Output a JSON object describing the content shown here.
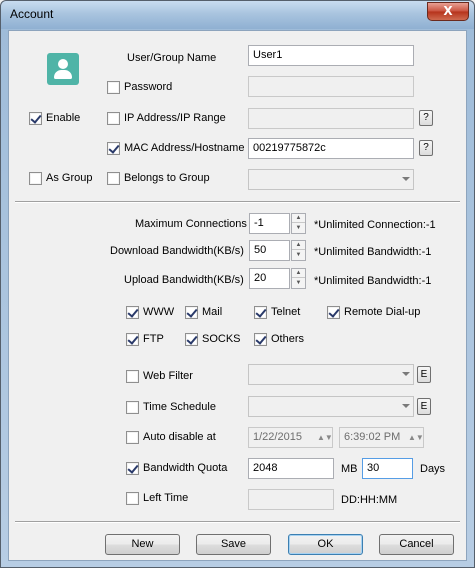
{
  "window": {
    "title": "Account",
    "close_glyph": "X"
  },
  "user": {
    "name_label": "User/Group Name",
    "name_value": "User1",
    "password_label": "Password",
    "password_checked": false,
    "password_value": "",
    "enable_label": "Enable",
    "enable_checked": true,
    "ip_label": "IP Address/IP Range",
    "ip_checked": false,
    "ip_value": "",
    "ip_help": "?",
    "mac_label": "MAC Address/Hostname",
    "mac_checked": true,
    "mac_value": "00219775872c",
    "mac_help": "?",
    "as_group_label": "As Group",
    "as_group_checked": false,
    "belongs_label": "Belongs to Group",
    "belongs_checked": false,
    "belongs_value": ""
  },
  "limits": {
    "max_conn_label": "Maximum Connections",
    "max_conn_value": "-1",
    "max_conn_note": "*Unlimited Connection:-1",
    "download_label": "Download Bandwidth(KB/s)",
    "download_value": "50",
    "download_note": "*Unlimited Bandwidth:-1",
    "upload_label": "Upload Bandwidth(KB/s)",
    "upload_value": "20",
    "upload_note": "*Unlimited Bandwidth:-1"
  },
  "services": [
    {
      "label": "WWW",
      "checked": true
    },
    {
      "label": "Mail",
      "checked": true
    },
    {
      "label": "Telnet",
      "checked": true
    },
    {
      "label": "Remote Dial-up",
      "checked": true
    },
    {
      "label": "FTP",
      "checked": true
    },
    {
      "label": "SOCKS",
      "checked": true
    },
    {
      "label": "Others",
      "checked": true
    }
  ],
  "filters": {
    "web_filter_label": "Web Filter",
    "web_filter_checked": false,
    "web_filter_edit": "E",
    "schedule_label": "Time Schedule",
    "schedule_checked": false,
    "schedule_edit": "E",
    "auto_disable_label": "Auto disable at",
    "auto_disable_checked": false,
    "auto_disable_date": "1/22/2015",
    "auto_disable_time": "6:39:02 PM",
    "quota_label": "Bandwidth Quota",
    "quota_checked": true,
    "quota_value": "2048",
    "quota_unit": "MB",
    "quota_days": "30",
    "quota_days_unit": "Days",
    "left_time_label": "Left Time",
    "left_time_checked": false,
    "left_time_value": "",
    "left_time_format": "DD:HH:MM"
  },
  "buttons": {
    "new": "New",
    "save": "Save",
    "ok": "OK",
    "cancel": "Cancel"
  },
  "colors": {
    "avatar": "#4fb4a7",
    "close": "#c9513d"
  },
  "icons": {
    "avatar": "user-icon",
    "spin": "spin-arrows-icon",
    "combo": "chevron-down-icon"
  }
}
